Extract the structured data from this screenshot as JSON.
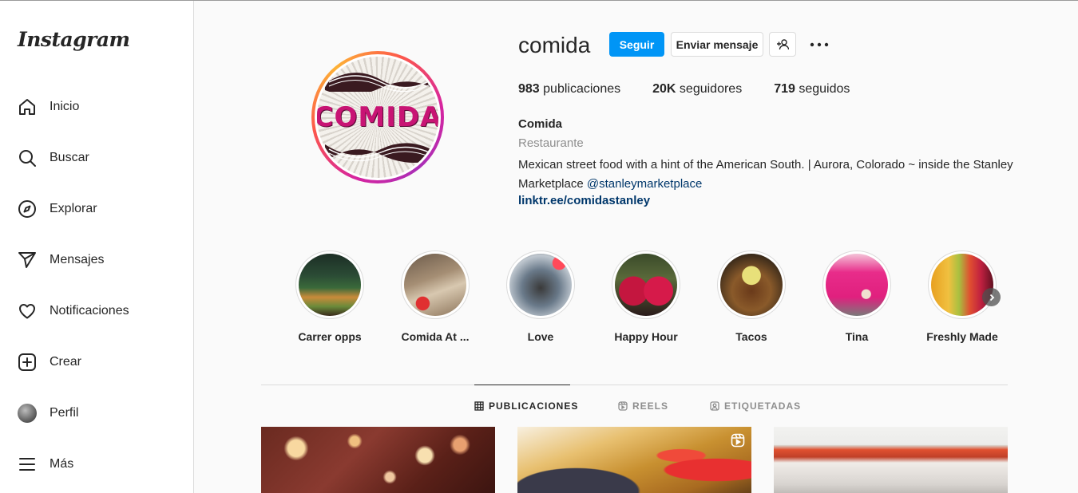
{
  "sidebar": {
    "logo": "Instagram",
    "items": [
      {
        "label": "Inicio",
        "icon": "home-icon"
      },
      {
        "label": "Buscar",
        "icon": "search-icon"
      },
      {
        "label": "Explorar",
        "icon": "compass-icon"
      },
      {
        "label": "Mensajes",
        "icon": "send-icon"
      },
      {
        "label": "Notificaciones",
        "icon": "heart-icon"
      },
      {
        "label": "Crear",
        "icon": "plus-square-icon"
      },
      {
        "label": "Perfil",
        "icon": "avatar"
      },
      {
        "label": "Más",
        "icon": "menu-icon"
      }
    ]
  },
  "profile": {
    "username": "comida",
    "picture_text": "COMIDA",
    "follow_label": "Seguir",
    "message_label": "Enviar mensaje",
    "stats": {
      "posts_count": "983",
      "posts_label": "publicaciones",
      "followers_count": "20K",
      "followers_label": "seguidores",
      "following_count": "719",
      "following_label": "seguidos"
    },
    "name": "Comida",
    "category": "Restaurante",
    "bio_text": "Mexican street food with a hint of the American South. | Aurora, Colorado ~ inside the Stanley Marketplace ",
    "bio_mention": "@stanleymarketplace",
    "link": "linktr.ee/comidastanley"
  },
  "highlights": [
    {
      "label": "Carrer opps"
    },
    {
      "label": "Comida At ..."
    },
    {
      "label": "Love"
    },
    {
      "label": "Happy Hour"
    },
    {
      "label": "Tacos"
    },
    {
      "label": "Tina"
    },
    {
      "label": "Freshly Made"
    }
  ],
  "tabs": [
    {
      "label": "PUBLICACIONES",
      "icon": "grid-icon",
      "active": true
    },
    {
      "label": "REELS",
      "icon": "reels-icon",
      "active": false
    },
    {
      "label": "ETIQUETADAS",
      "icon": "tagged-icon",
      "active": false
    }
  ],
  "colors": {
    "accent": "#0095f6",
    "link": "#00376b",
    "brand_pink": "#c81474"
  }
}
